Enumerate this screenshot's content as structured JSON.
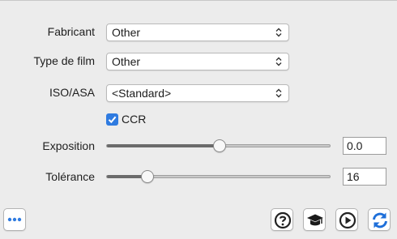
{
  "fields": {
    "maker_label": "Fabricant",
    "maker_value": "Other",
    "film_type_label": "Type de film",
    "film_type_value": "Other",
    "iso_label": "ISO/ASA",
    "iso_value": "<Standard>"
  },
  "ccr": {
    "label": "CCR",
    "checked": true
  },
  "exposure": {
    "label": "Exposition",
    "value": "0.0",
    "slider_fraction": 0.5
  },
  "tolerance": {
    "label": "Tolérance",
    "value": "16",
    "slider_fraction": 0.16
  },
  "toolbar": {
    "more_icon": "ellipsis-icon",
    "help_icon": "question-icon",
    "tutorial_icon": "graduation-cap-icon",
    "play_icon": "play-icon",
    "refresh_icon": "refresh-icon"
  },
  "colors": {
    "accent": "#2f7be0"
  }
}
